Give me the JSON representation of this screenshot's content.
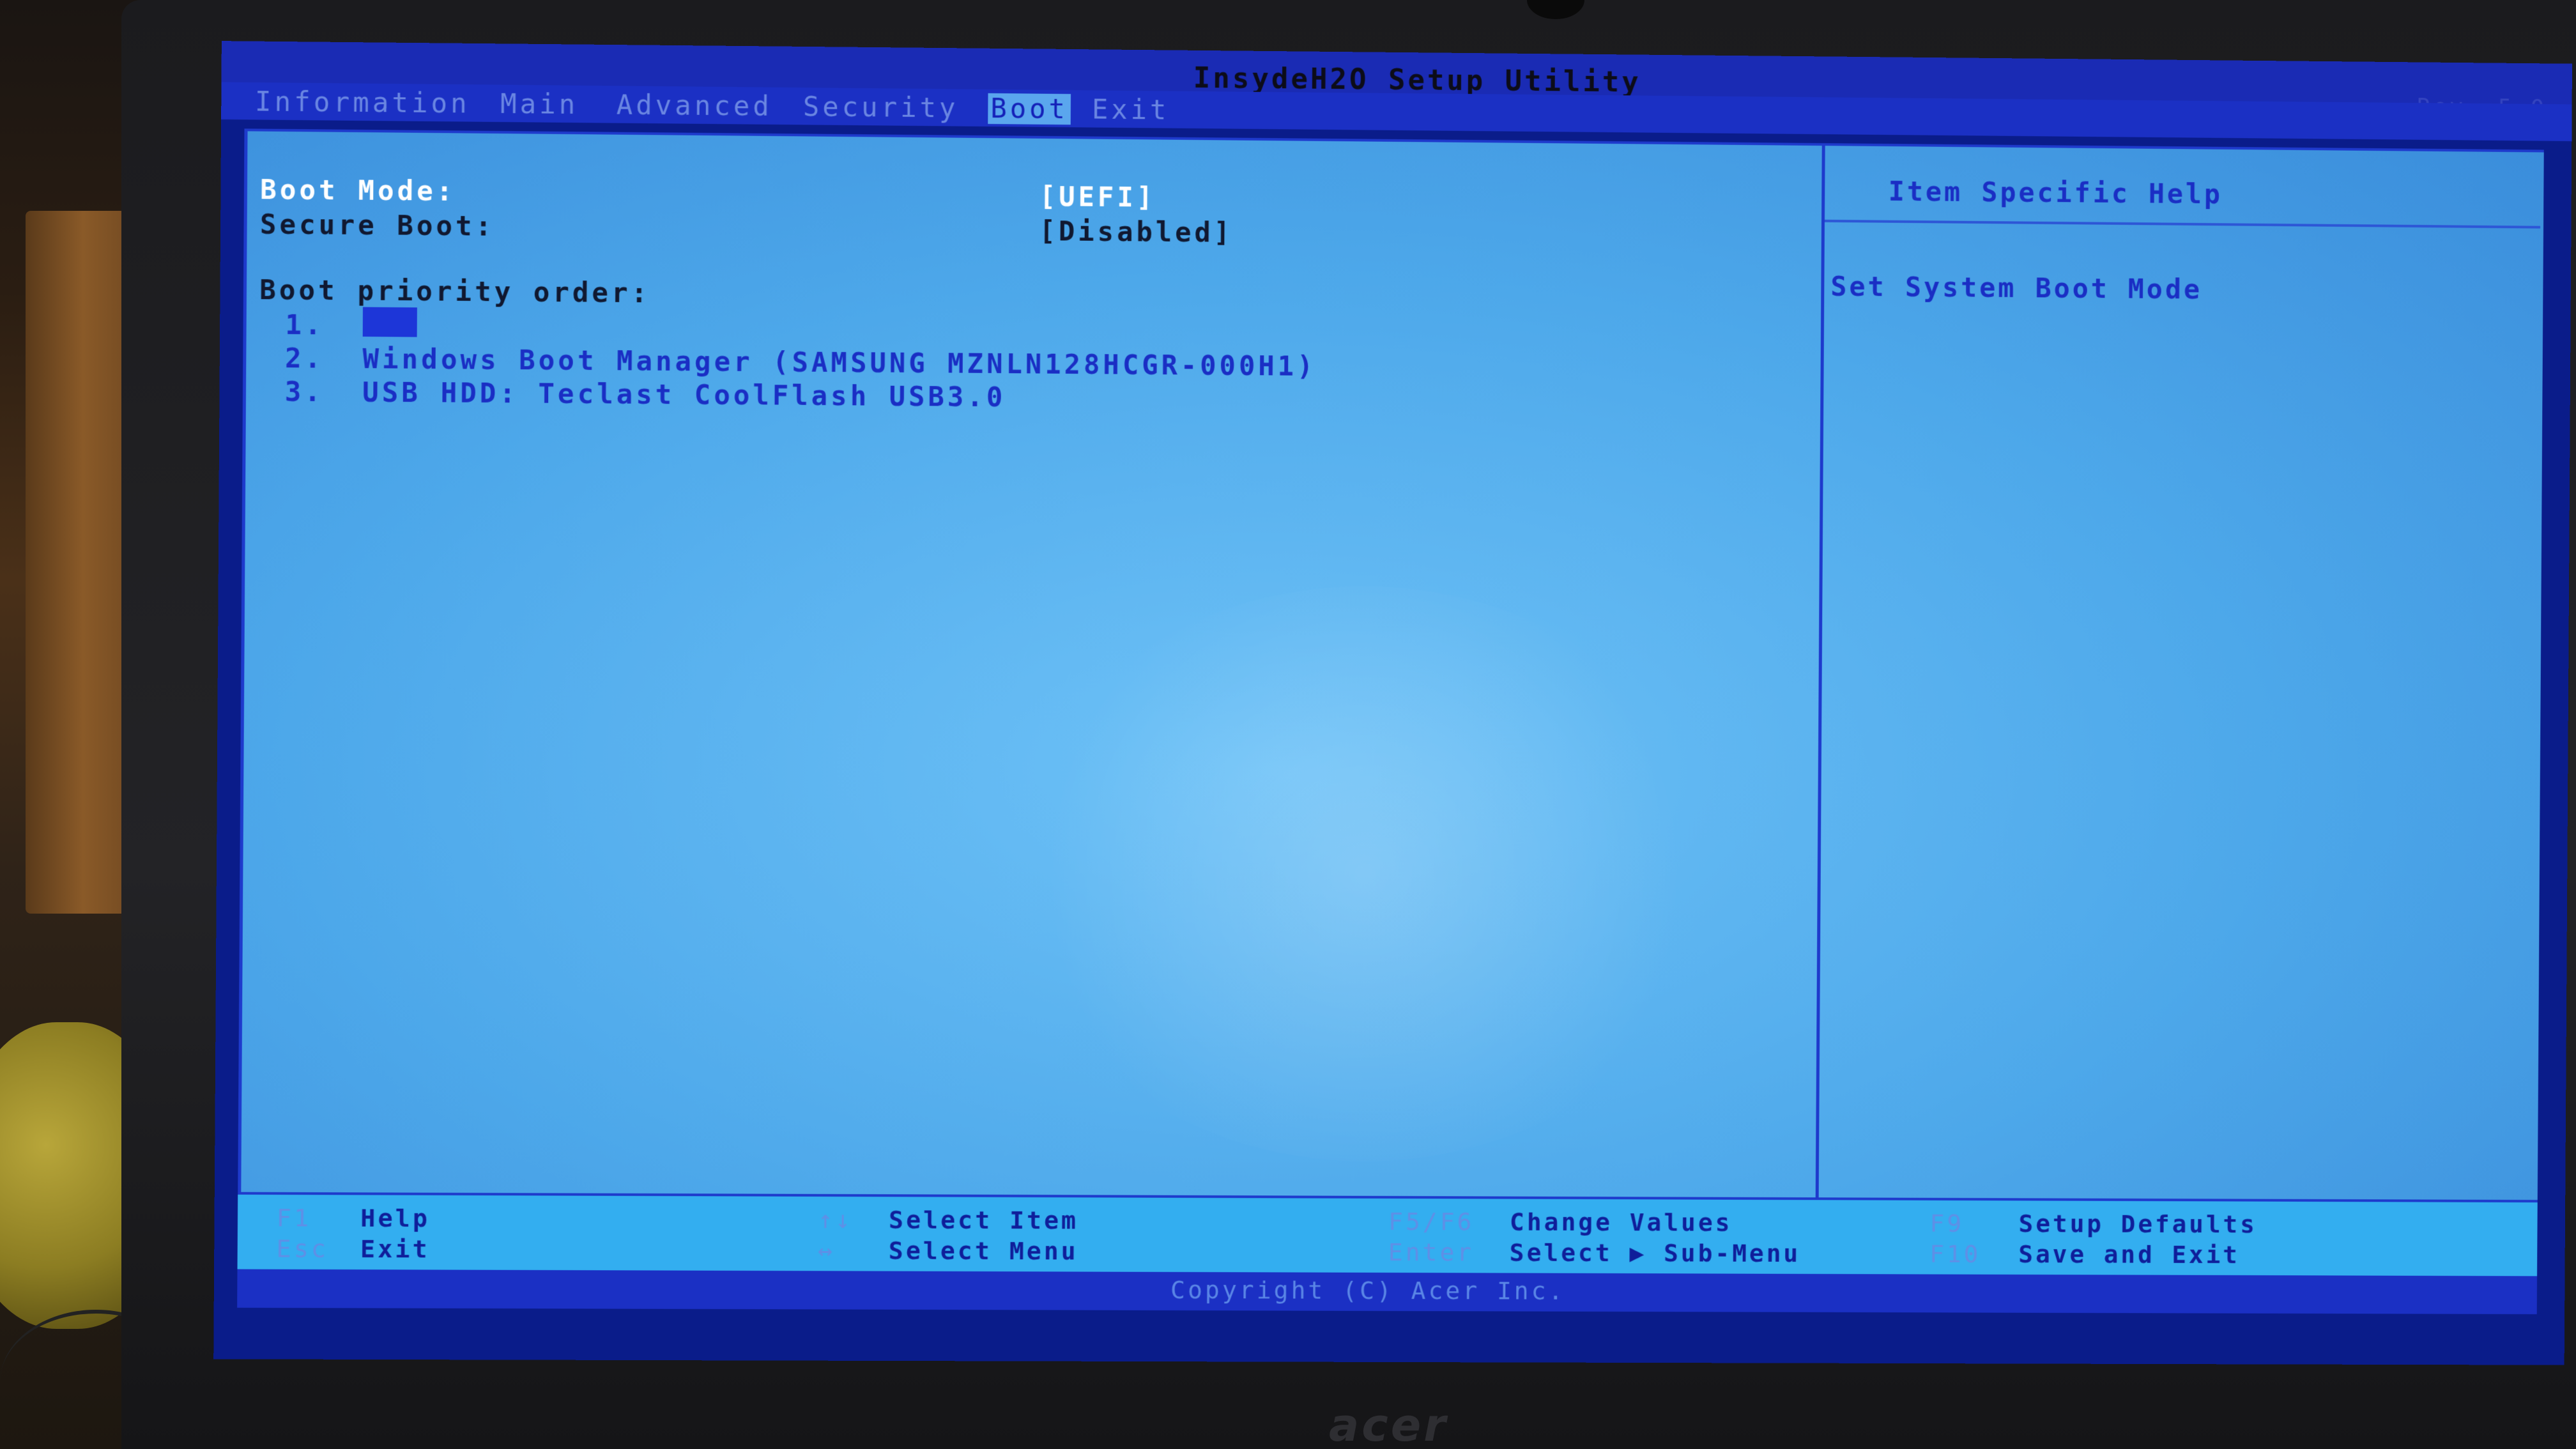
{
  "utility": {
    "title": "InsydeH2O Setup Utility",
    "revision": "Rev. 5.0"
  },
  "menu": {
    "tabs": [
      {
        "label": "Information"
      },
      {
        "label": "Main"
      },
      {
        "label": "Advanced"
      },
      {
        "label": "Security"
      },
      {
        "label": "Boot",
        "active": true
      },
      {
        "label": "Exit"
      }
    ]
  },
  "settings": {
    "boot_mode_label": "Boot Mode:",
    "boot_mode_value": "[UEFI]",
    "secure_boot_label": "Secure Boot:",
    "secure_boot_value": "[Disabled]",
    "boot_priority_label": "Boot priority order:",
    "boot_items": [
      {
        "number": "1.",
        "name": ""
      },
      {
        "number": "2.",
        "name": "Windows Boot Manager (SAMSUNG MZNLN128HCGR-000H1)"
      },
      {
        "number": "3.",
        "name": "USB HDD: Teclast CoolFlash USB3.0"
      }
    ]
  },
  "help_panel": {
    "title": "Item Specific Help",
    "text": "Set System Boot Mode"
  },
  "footer": {
    "keys": [
      {
        "key": "F1",
        "desc": "Help"
      },
      {
        "key": "Esc",
        "desc": "Exit"
      },
      {
        "key": "↑↓",
        "desc": "Select Item"
      },
      {
        "key": "↔",
        "desc": "Select Menu"
      },
      {
        "key": "F5/F6",
        "desc": "Change Values"
      },
      {
        "key": "Enter",
        "desc": "Select ▶ Sub-Menu"
      },
      {
        "key": "F9",
        "desc": "Setup Defaults"
      },
      {
        "key": "F10",
        "desc": "Save and Exit"
      }
    ],
    "copyright": "Copyright (C) Acer Inc."
  },
  "hardware": {
    "brand_logo": "acer"
  },
  "colors": {
    "menu_bar": "#1b30c4",
    "content_bg": "#4da8ea",
    "active_tab_bg": "#5aa6ee",
    "highlight_text": "#ffffff",
    "item_text": "#1a2ec4"
  }
}
